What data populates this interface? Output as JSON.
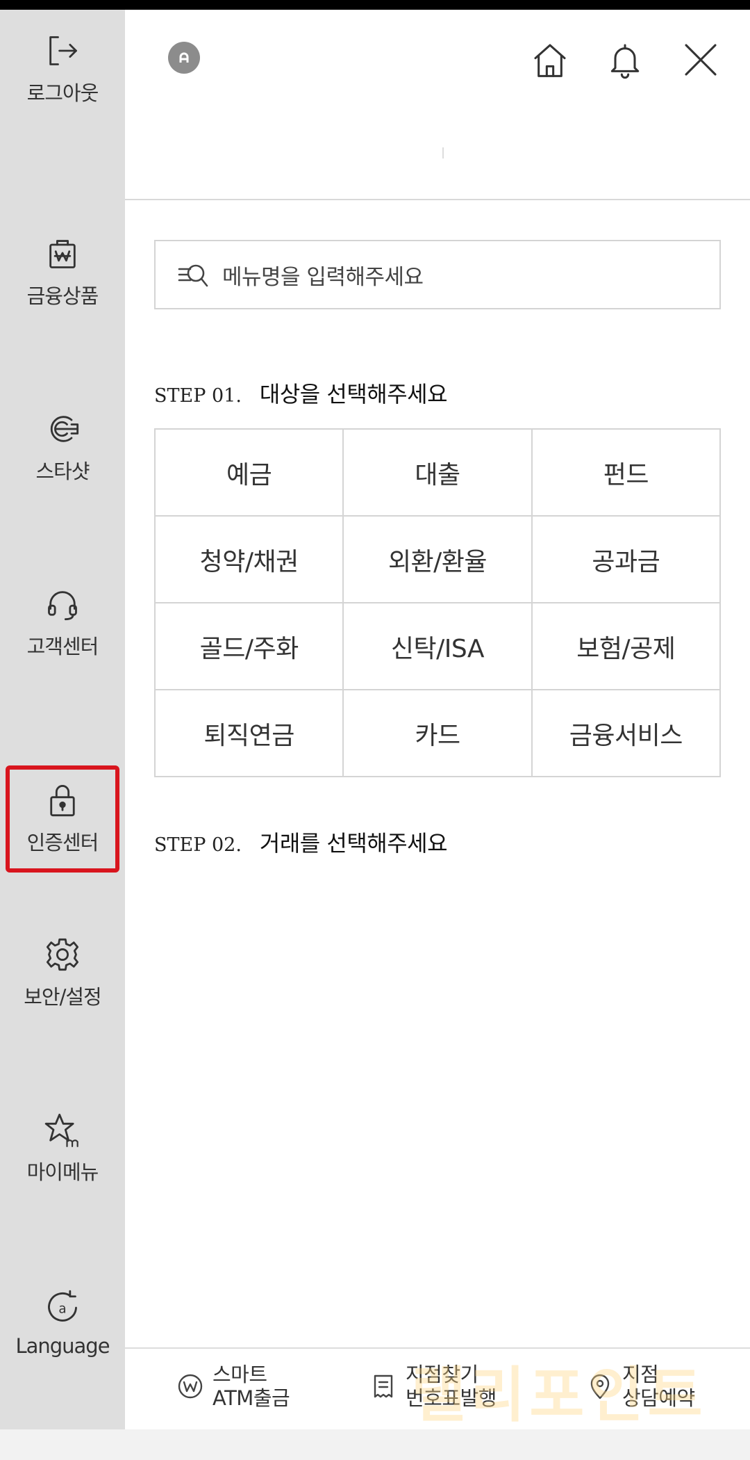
{
  "sidebar": {
    "items": [
      {
        "label": "로그아웃",
        "icon": "logout-icon"
      },
      {
        "label": "금융상품",
        "icon": "finance-bag-icon"
      },
      {
        "label": "스타샷",
        "icon": "starshot-icon"
      },
      {
        "label": "고객센터",
        "icon": "headset-icon"
      },
      {
        "label": "인증센터",
        "icon": "lock-icon",
        "active": true
      },
      {
        "label": "보안/설정",
        "icon": "gear-icon"
      },
      {
        "label": "마이메뉴",
        "icon": "star-m-icon"
      },
      {
        "label": "Language",
        "icon": "language-icon"
      }
    ]
  },
  "header": {
    "avatar_icon": "user-avatar-icon",
    "home_icon": "home-icon",
    "bell_icon": "bell-icon",
    "close_icon": "close-icon"
  },
  "search": {
    "placeholder": "메뉴명을 입력해주세요",
    "icon": "menu-search-icon"
  },
  "step1": {
    "number": "STEP 01.",
    "title": "대상을 선택해주세요",
    "categories": [
      "예금",
      "대출",
      "펀드",
      "청약/채권",
      "외환/환율",
      "공과금",
      "골드/주화",
      "신탁/ISA",
      "보험/공제",
      "퇴직연금",
      "카드",
      "금융서비스"
    ]
  },
  "step2": {
    "number": "STEP 02.",
    "title": "거래를 선택해주세요"
  },
  "footer": {
    "items": [
      {
        "line1": "스마트",
        "line2": "ATM출금",
        "icon": "won-coin-icon"
      },
      {
        "line1": "지점찾기",
        "line2": "번호표발행",
        "icon": "ticket-icon"
      },
      {
        "line1": "지점",
        "line2": "상담예약",
        "icon": "location-pin-icon"
      }
    ]
  },
  "watermark": "랠리포인트",
  "colors": {
    "sidebar_bg": "#dedede",
    "active_border": "#d8151e",
    "grid_border": "#d4d4d4"
  }
}
